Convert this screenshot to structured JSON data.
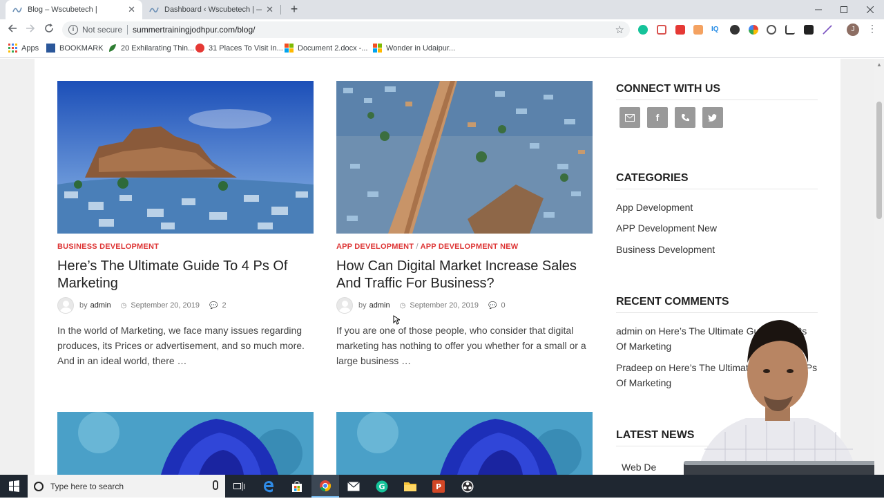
{
  "browser": {
    "tabs": [
      {
        "title": "Blog – Wscubetech |",
        "active": true
      },
      {
        "title": "Dashboard ‹ Wscubetech | — Wo",
        "active": false
      }
    ],
    "omnibox": {
      "security": "Not secure",
      "url": "summertrainingjodhpur.com/blog/"
    },
    "profile_initial": "J",
    "bookmarks": [
      {
        "label": "Apps",
        "icon": "apps-grid-icon"
      },
      {
        "label": "BOOKMARK",
        "icon": "word-icon"
      },
      {
        "label": "20 Exhilarating Thin...",
        "icon": "leaf-icon"
      },
      {
        "label": "31 Places To Visit In...",
        "icon": "red-circle-icon"
      },
      {
        "label": "Document 2.docx -...",
        "icon": "office-icon"
      },
      {
        "label": "Wonder in Udaipur...",
        "icon": "office-icon"
      }
    ]
  },
  "posts": [
    {
      "category": "BUSINESS DEVELOPMENT",
      "title": "Here’s The Ultimate Guide To 4 Ps Of Marketing",
      "by": "by",
      "author": "admin",
      "date": "September 20, 2019",
      "comments": "2",
      "excerpt": "In the world of Marketing, we face many issues regarding produces, its Prices or advertisement, and so much more. And in an ideal world, there …"
    },
    {
      "categories": [
        "APP DEVELOPMENT",
        "APP DEVELOPMENT NEW"
      ],
      "category_sep": "/",
      "title": "How Can Digital Market Increase Sales And Traffic For Business?",
      "by": "by",
      "author": "admin",
      "date": "September 20, 2019",
      "comments": "0",
      "excerpt": "If you are one of those people, who consider that digital marketing has nothing to offer you whether for a small or a large business …"
    }
  ],
  "sidebar": {
    "connect_title": "CONNECT WITH US",
    "social": [
      "email-icon",
      "facebook-icon",
      "phone-icon",
      "twitter-icon"
    ],
    "categories_title": "CATEGORIES",
    "categories": [
      "App Development",
      "APP Development New",
      "Business Development"
    ],
    "recent_comments_title": "RECENT COMMENTS",
    "recent_comments": [
      {
        "author": "admin",
        "on": "on",
        "post": "Here’s The Ultimate Guide To 4 Ps Of Marketing"
      },
      {
        "author": "Pradeep",
        "on": "on",
        "post": "Here’s The Ultimate Guide To 4 Ps Of Marketing"
      }
    ],
    "latest_news_title": "LATEST NEWS",
    "latest_news_item": "Web De"
  },
  "taskbar": {
    "search_placeholder": "Type here to search"
  },
  "colors": {
    "category_red": "#dd3333",
    "taskbar": "#1f2731",
    "social_grey": "#999999"
  }
}
